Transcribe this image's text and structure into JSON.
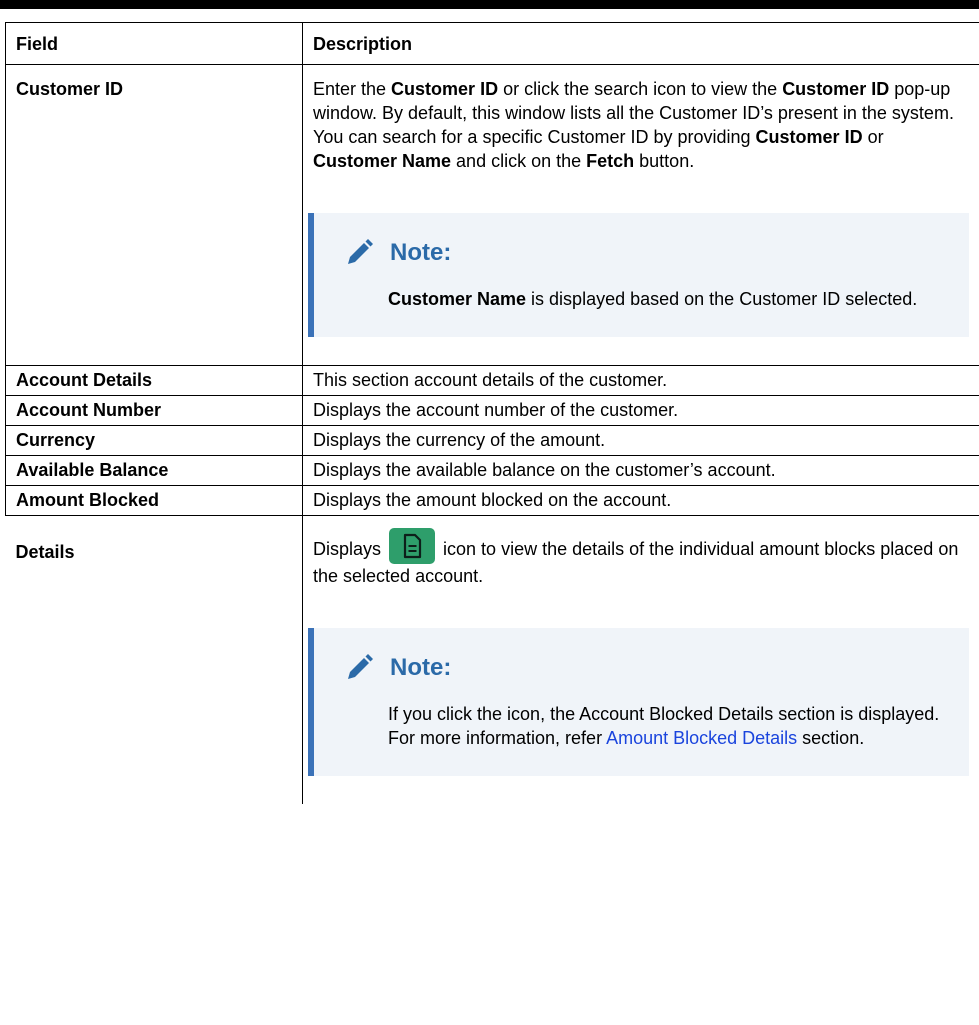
{
  "table": {
    "headers": {
      "field": "Field",
      "description": "Description"
    },
    "rows": {
      "customer_id": {
        "field": "Customer ID",
        "desc": [
          "Enter the ",
          "Customer ID",
          " or click the search icon to view the ",
          "Customer ID",
          " pop-up window. By default, this window lists all the Customer ID’s present in the system. You can search for a specific Customer ID by providing ",
          "Customer ID",
          " or ",
          "Customer Name",
          " and click on the ",
          "Fetch",
          " button."
        ],
        "note": {
          "title": "Note:",
          "body": [
            "Customer Name",
            " is displayed based on the Customer ID selected."
          ]
        }
      },
      "account_details": {
        "field": "Account Details",
        "desc": "This section account details of the customer."
      },
      "account_number": {
        "field": "Account Number",
        "desc": "Displays the account number of the customer."
      },
      "currency": {
        "field": "Currency",
        "desc": "Displays the currency of the amount."
      },
      "available_balance": {
        "field": "Available Balance",
        "desc": "Displays the available balance on the customer’s account."
      },
      "amount_blocked": {
        "field": "Amount Blocked",
        "desc": "Displays the amount blocked on the account."
      },
      "details": {
        "field": "Details",
        "desc_before": "Displays ",
        "desc_after": " icon to view the details of the individual amount blocks placed on the selected account.",
        "icon": "document-icon",
        "icon_color": "#2e9e6b",
        "note": {
          "title": "Note:",
          "body_before": "If you click the icon, the Account Blocked Details section is displayed. For more information, refer ",
          "link": "Amount Blocked Details",
          "body_after": " section."
        }
      }
    }
  },
  "colors": {
    "note_accent": "#3b72b8",
    "note_title": "#2b6aa8",
    "note_bg": "#f0f4f9",
    "link": "#1a44dd"
  }
}
